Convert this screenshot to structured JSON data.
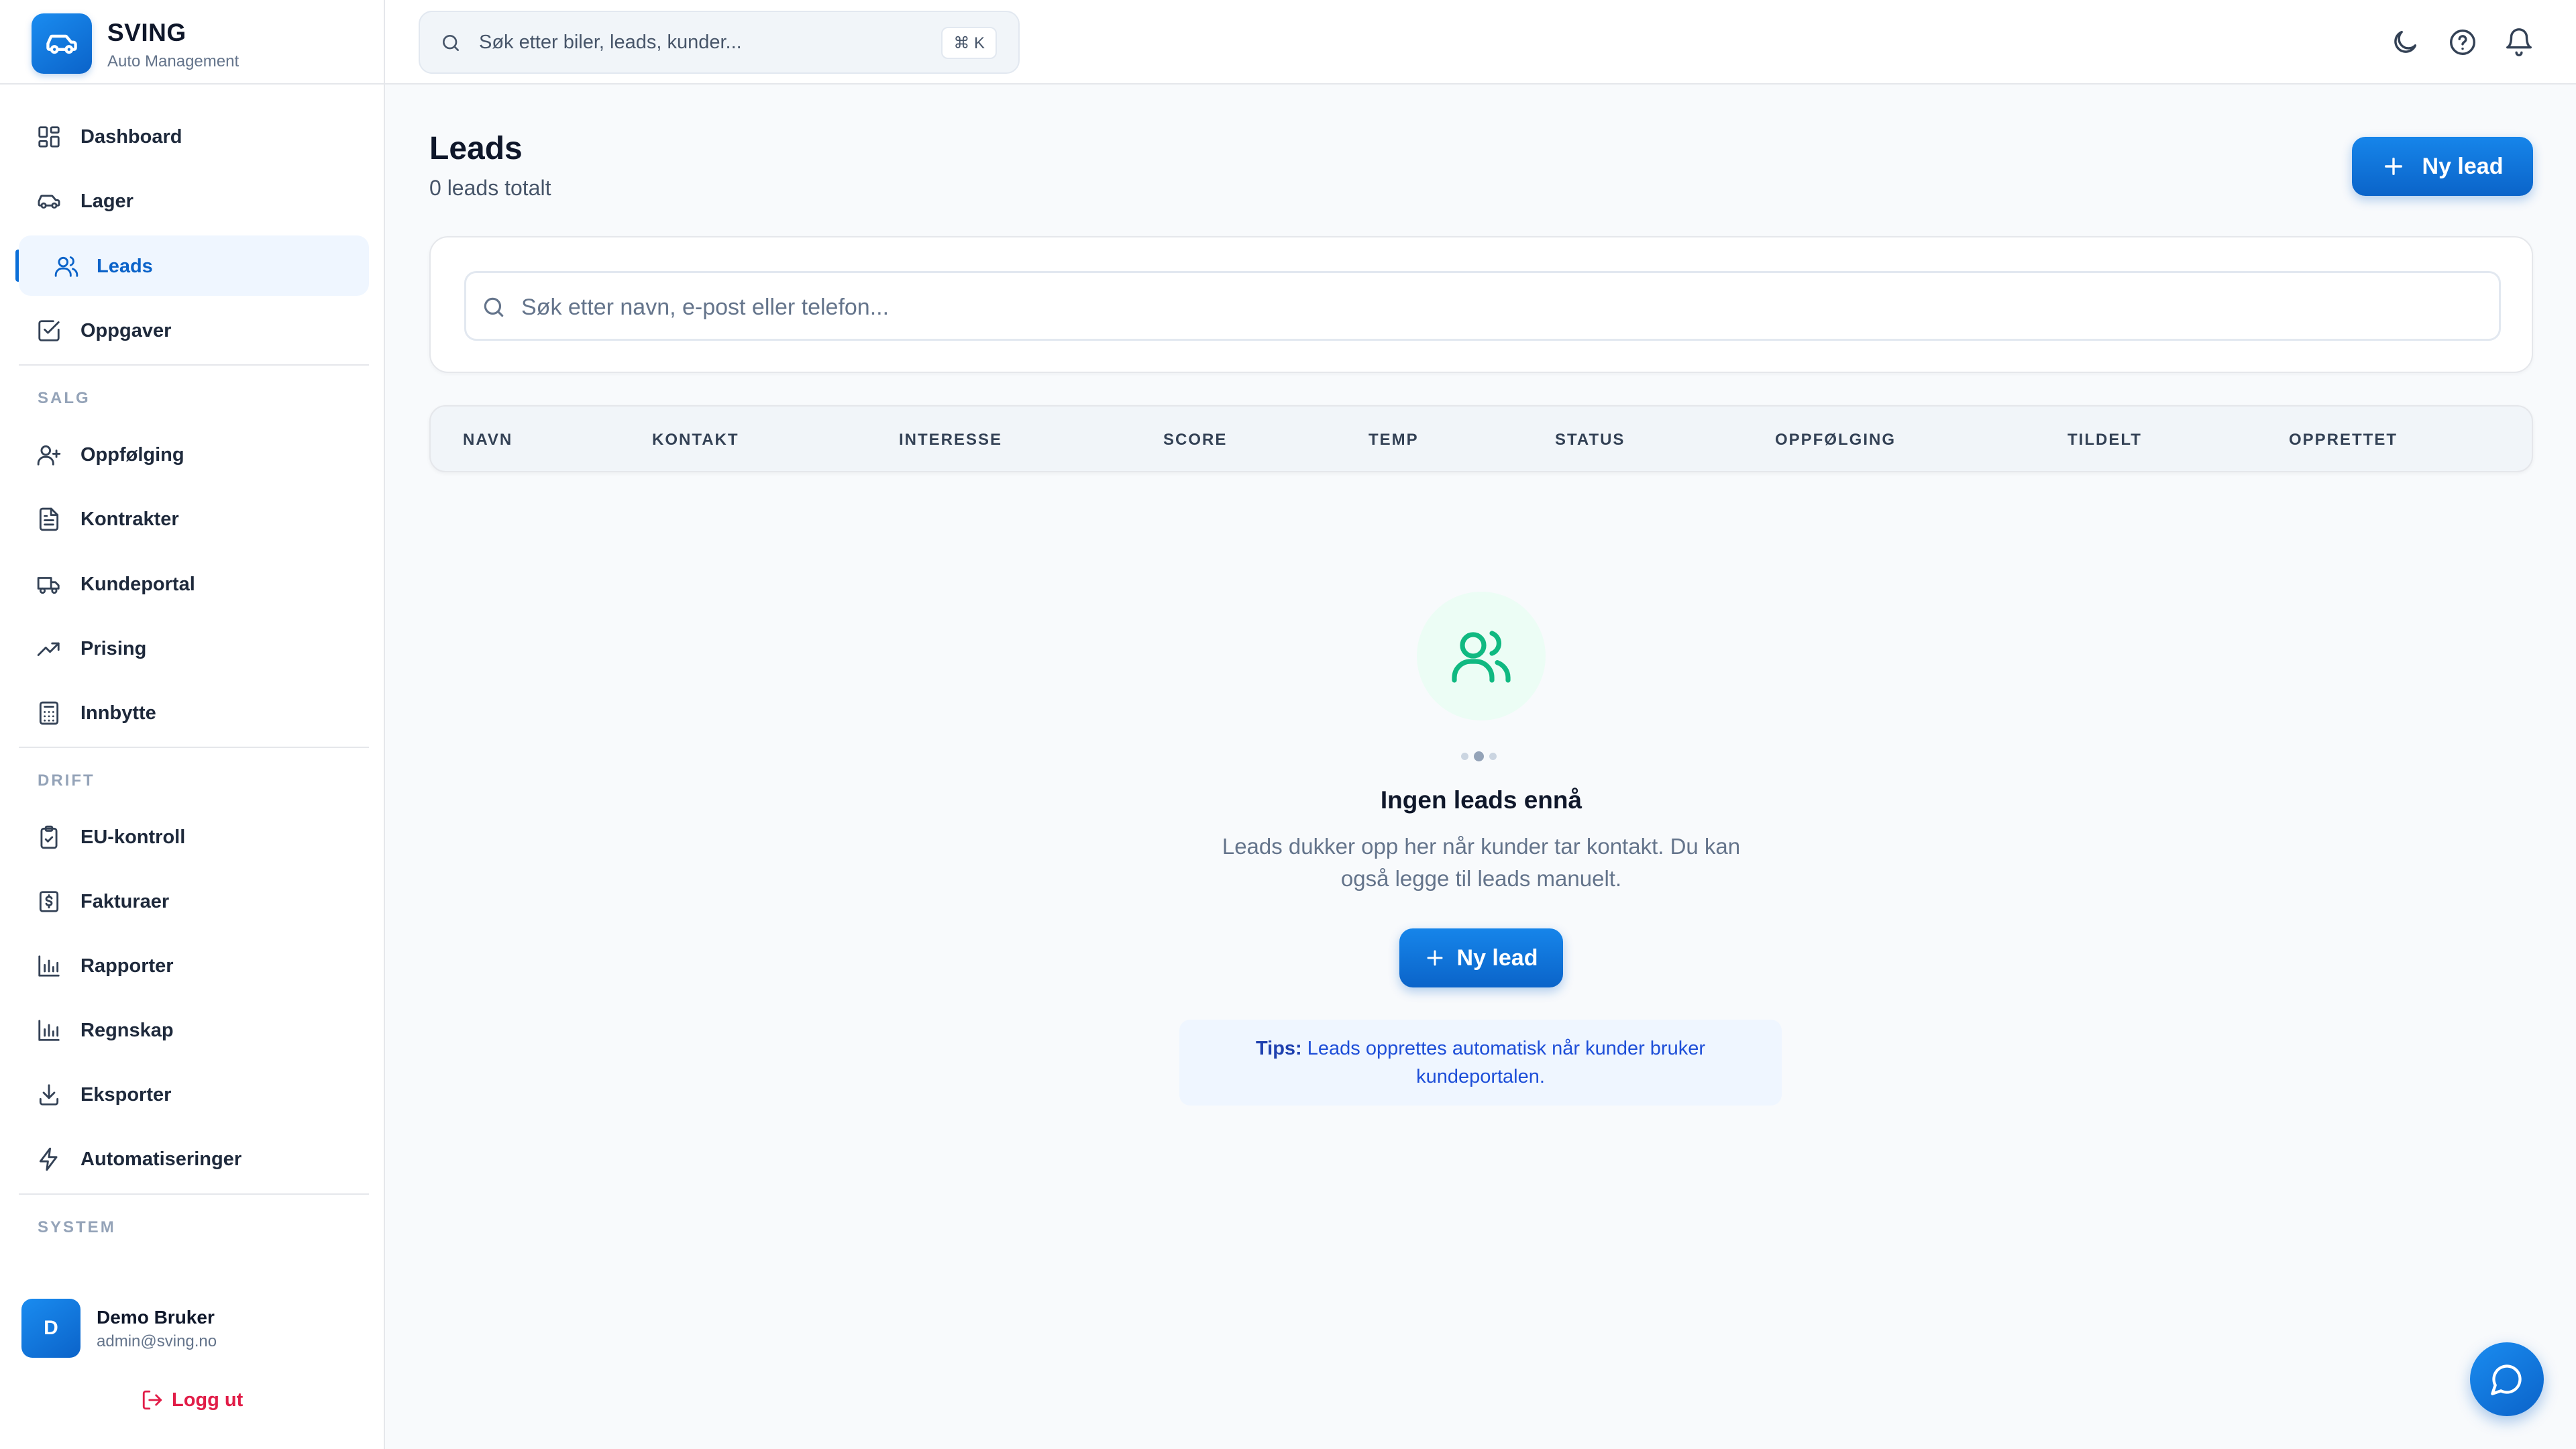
{
  "brand": {
    "name": "SVING",
    "subtitle": "Auto Management"
  },
  "nav": {
    "main": [
      {
        "label": "Dashboard",
        "icon": "grid-icon"
      },
      {
        "label": "Lager",
        "icon": "car-icon"
      },
      {
        "label": "Leads",
        "icon": "users-icon",
        "active": true
      },
      {
        "label": "Oppgaver",
        "icon": "checkbox-icon"
      }
    ],
    "salg_title": "SALG",
    "salg": [
      {
        "label": "Oppfølging",
        "icon": "user-plus-icon"
      },
      {
        "label": "Kontrakter",
        "icon": "document-icon"
      },
      {
        "label": "Kundeportal",
        "icon": "truck-icon"
      },
      {
        "label": "Prising",
        "icon": "trending-up-icon"
      },
      {
        "label": "Innbytte",
        "icon": "calculator-icon"
      }
    ],
    "drift_title": "DRIFT",
    "drift": [
      {
        "label": "EU-kontroll",
        "icon": "clipboard-check-icon"
      },
      {
        "label": "Fakturaer",
        "icon": "invoice-dollar-icon"
      },
      {
        "label": "Rapporter",
        "icon": "bar-chart-icon"
      },
      {
        "label": "Regnskap",
        "icon": "bar-chart-icon"
      },
      {
        "label": "Eksporter",
        "icon": "download-icon"
      },
      {
        "label": "Automatiseringer",
        "icon": "lightning-icon"
      }
    ],
    "system_title": "SYSTEM"
  },
  "user": {
    "initial": "D",
    "name": "Demo Bruker",
    "email": "admin@sving.no",
    "logout_label": "Logg ut"
  },
  "topbar": {
    "search_placeholder": "Søk etter biler, leads, kunder...",
    "shortcut": "⌘ K",
    "icons": [
      "moon-icon",
      "help-icon",
      "bell-icon"
    ]
  },
  "page": {
    "title": "Leads",
    "subtitle": "0 leads totalt",
    "new_button": "Ny lead",
    "search_placeholder": "Søk etter navn, e-post eller telefon..."
  },
  "table": {
    "columns": [
      "NAVN",
      "KONTAKT",
      "INTERESSE",
      "SCORE",
      "TEMP",
      "STATUS",
      "OPPFØLGING",
      "TILDELT",
      "OPPRETTET"
    ],
    "rows": []
  },
  "empty_state": {
    "title": "Ingen leads ennå",
    "description": "Leads dukker opp her når kunder tar kontakt. Du kan også legge til leads manuelt.",
    "button": "Ny lead",
    "tip_label": "Tips:",
    "tip_text": "Leads opprettes automatisk når kunder bruker kundeportalen."
  },
  "colors": {
    "primary": "#0b6fd8",
    "active_bg": "#eff6ff",
    "empty_icon": "#10b981",
    "logout": "#e11d48",
    "tip_bg": "#eff6ff"
  }
}
